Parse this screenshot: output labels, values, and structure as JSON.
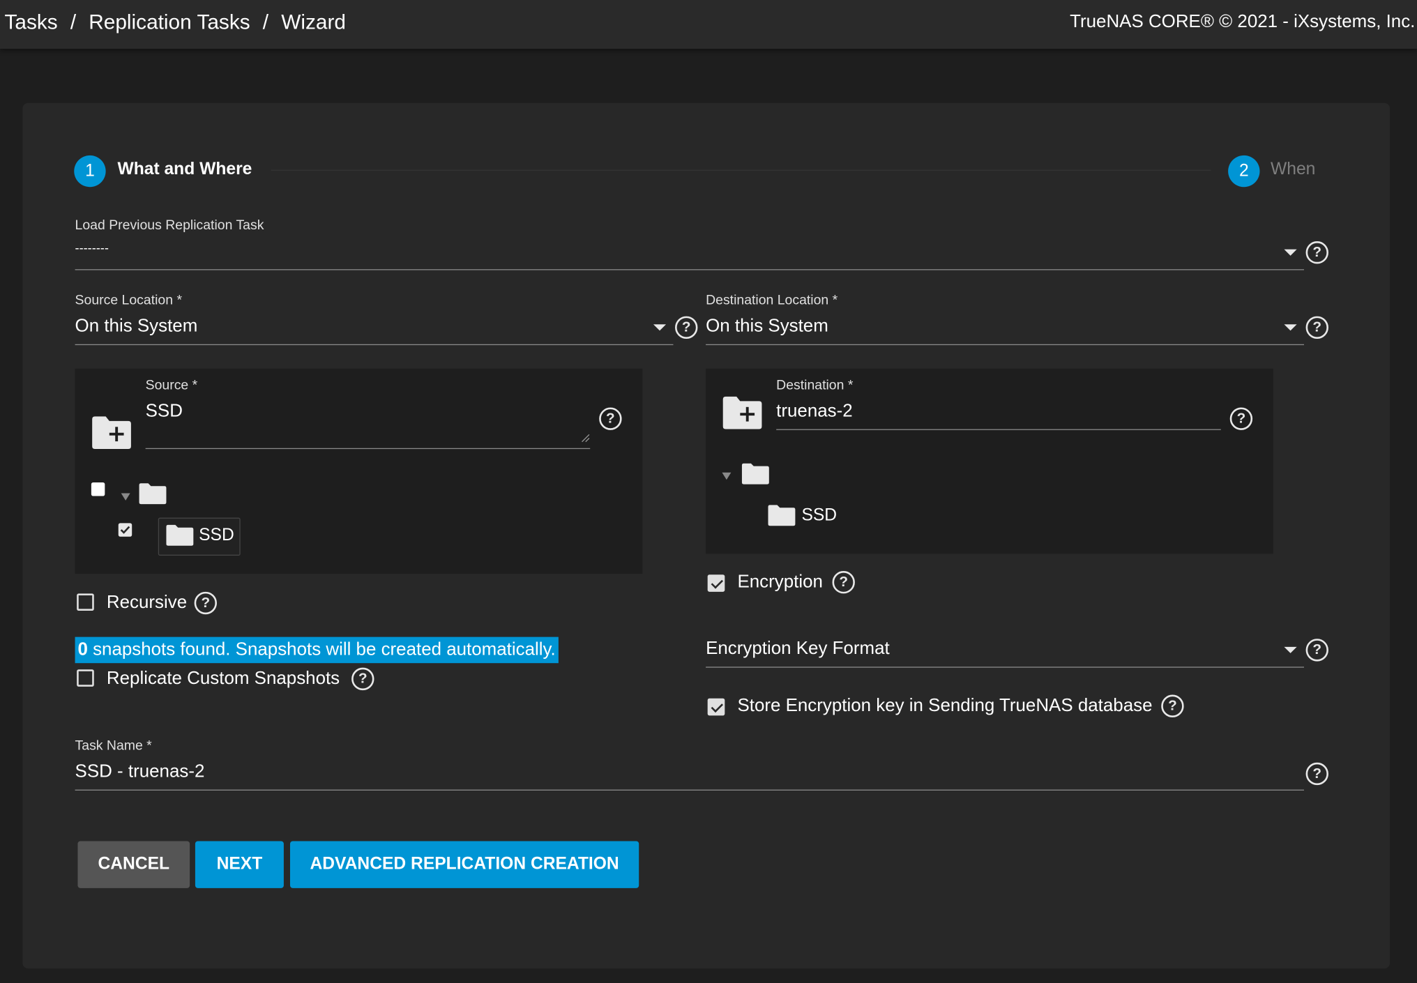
{
  "breadcrumb": {
    "items": [
      "Tasks",
      "Replication Tasks",
      "Wizard"
    ],
    "separator": "/"
  },
  "copyright": "TrueNAS CORE® © 2021 - iXsystems, Inc.",
  "stepper": {
    "steps": [
      {
        "number": "1",
        "label": "What and Where",
        "active": true
      },
      {
        "number": "2",
        "label": "When",
        "active": false
      }
    ]
  },
  "load_previous": {
    "label": "Load Previous Replication Task",
    "value": "--------"
  },
  "source_location": {
    "label": "Source Location *",
    "value": "On this System"
  },
  "destination_location": {
    "label": "Destination Location *",
    "value": "On this System"
  },
  "source": {
    "label": "Source *",
    "value": "SSD",
    "tree": {
      "root_checked": false,
      "child_label": "SSD",
      "child_checked": true
    }
  },
  "destination": {
    "label": "Destination *",
    "value": "truenas-2",
    "tree": {
      "child_label": "SSD"
    }
  },
  "recursive": {
    "label": "Recursive",
    "checked": false
  },
  "snapshots_message": {
    "count": "0",
    "text": " snapshots found. Snapshots will be created automatically."
  },
  "replicate_custom": {
    "label": "Replicate Custom Snapshots",
    "checked": false
  },
  "encryption": {
    "label": "Encryption",
    "checked": true
  },
  "encryption_key_format": {
    "label": "Encryption Key Format",
    "value": ""
  },
  "store_key": {
    "label": "Store Encryption key in Sending TrueNAS database",
    "checked": true
  },
  "task_name": {
    "label": "Task Name *",
    "value": "SSD - truenas-2"
  },
  "buttons": {
    "cancel": "CANCEL",
    "next": "NEXT",
    "advanced": "ADVANCED REPLICATION CREATION"
  },
  "colors": {
    "accent": "#0095d5",
    "background": "#1e1e1e",
    "card": "#282828",
    "cancel_button": "#555555"
  },
  "icons": {
    "help": "help-circle-icon",
    "dropdown": "caret-down-icon",
    "folder": "folder-icon",
    "folder_add": "folder-plus-icon"
  }
}
